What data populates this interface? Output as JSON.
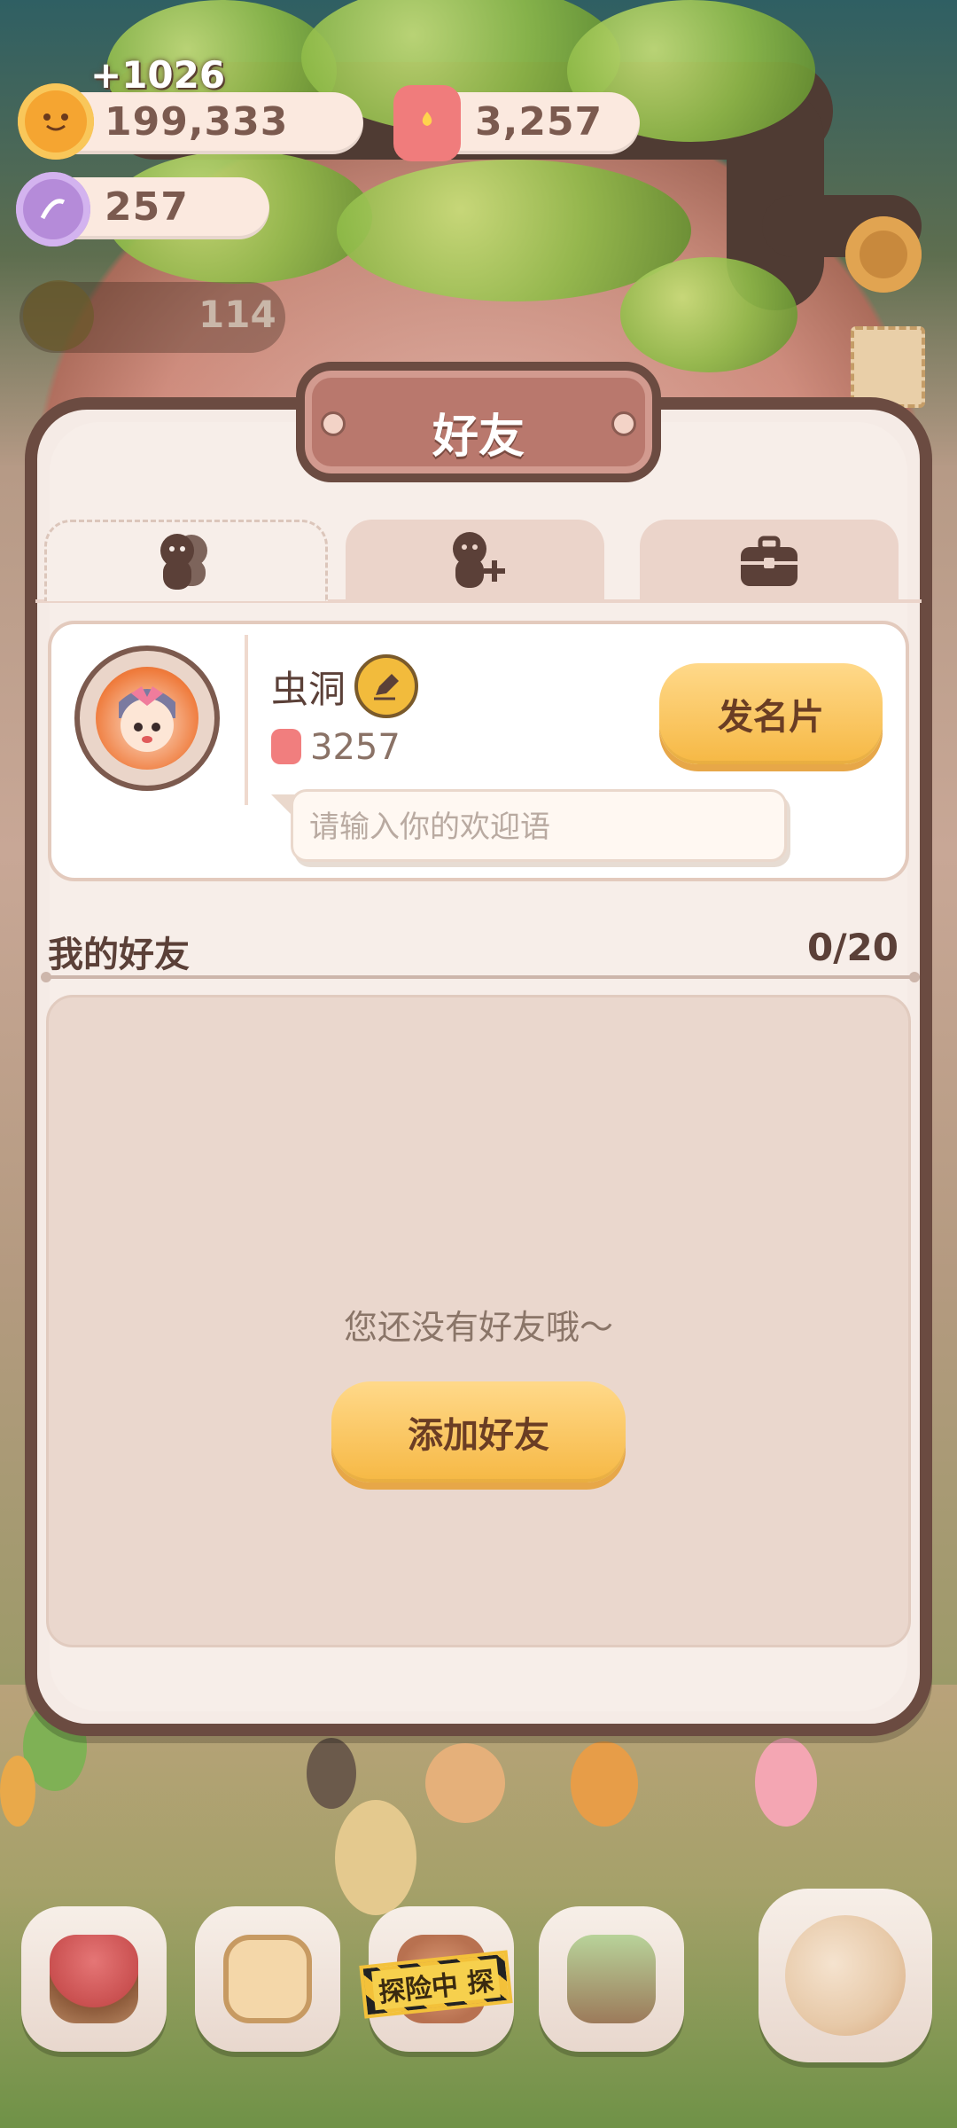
{
  "resources": {
    "coins_gain": "+1026",
    "coins": "199,333",
    "candles": "3,257",
    "candy": "257",
    "dim_count": "114"
  },
  "modal": {
    "title": "好友",
    "tabs": [
      {
        "icon": "friends-icon",
        "active": true
      },
      {
        "icon": "add-friend-icon",
        "active": false
      },
      {
        "icon": "briefcase-icon",
        "active": false
      }
    ],
    "profile": {
      "name": "虫洞",
      "score": "3257",
      "greeting_placeholder": "请输入你的欢迎语",
      "send_card_label": "发名片"
    },
    "friends": {
      "section_title": "我的好友",
      "count": "0/20",
      "empty_text": "您还没有好友哦～",
      "add_button_label": "添加好友"
    }
  },
  "dock": {
    "explore_label": "探险中 探",
    "items": [
      "mushroom-house-icon",
      "notebook-icon",
      "explore-icon",
      "shop-icon",
      "character-icon"
    ]
  },
  "colors": {
    "modal_border": "#6b4b41",
    "accent_button": "#f6b844",
    "panel_bg": "#ead7cd"
  }
}
